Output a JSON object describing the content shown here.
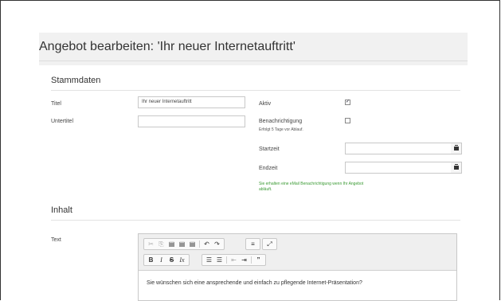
{
  "page": {
    "title": "Angebot bearbeiten: 'Ihr neuer Internetauftritt'"
  },
  "stammdaten": {
    "heading": "Stammdaten",
    "titel_label": "Titel",
    "titel_value": "Ihr neuer Internetauftritt",
    "untertitel_label": "Untertitel",
    "untertitel_value": "",
    "aktiv_label": "Aktiv",
    "aktiv_checked": "✓",
    "benachrichtigung_label": "Benachrichtigung",
    "benachrichtigung_hint": "Erfolgt 5 Tage vor Ablauf.",
    "startzeit_label": "Startzeit",
    "endzeit_label": "Endzeit",
    "info_line1": "Sie erhalten eine eMail Benachrichtigung wenn Ihr Angebot",
    "info_line2": "abläuft."
  },
  "inhalt": {
    "heading": "Inhalt",
    "text_label": "Text",
    "toolbar_row1": [
      "✂",
      "⎘",
      "▤",
      "▤",
      "▤",
      "↶",
      "↷",
      "≡",
      "⤢"
    ],
    "toolbar_row2": [
      "B",
      "I",
      "S",
      "Ix",
      "☰",
      "☰",
      "⇤",
      "⇥",
      "”"
    ],
    "editor_text": "Sie wünschen sich eine ansprechende und einfach zu pflegende Internet-Präsentation?"
  }
}
